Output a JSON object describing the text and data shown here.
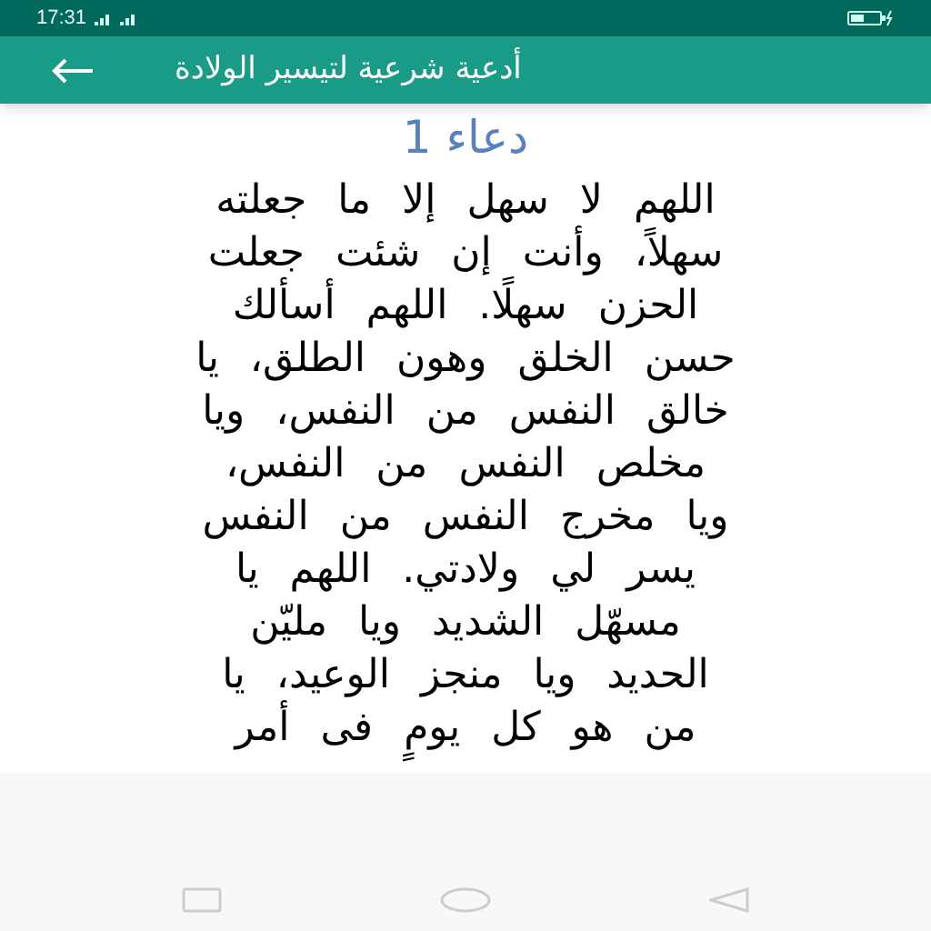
{
  "status_bar": {
    "time": "17:31"
  },
  "app_bar": {
    "title": "أدعية شرعية لتيسير الولادة"
  },
  "heading": "دعاء 1",
  "body_lines": [
    "اللهم لا سهل إلا ما جعلته",
    "سهلاً، وأنت إن شئت جعلت",
    "الحزن سهلًا. اللهم أسألك",
    "حسن الخلق وهون الطلق، يا",
    "خالق النفس من النفس، ويا",
    "مخلص النفس من النفس،",
    "ويا مخرج النفس من النفس",
    "يسر لي ولادتي. اللهم يا",
    "مسهّل الشديد ويا مليّن",
    "الحديد ويا منجز الوعيد، يا",
    "من هو كل يومٍ فى أمر"
  ]
}
